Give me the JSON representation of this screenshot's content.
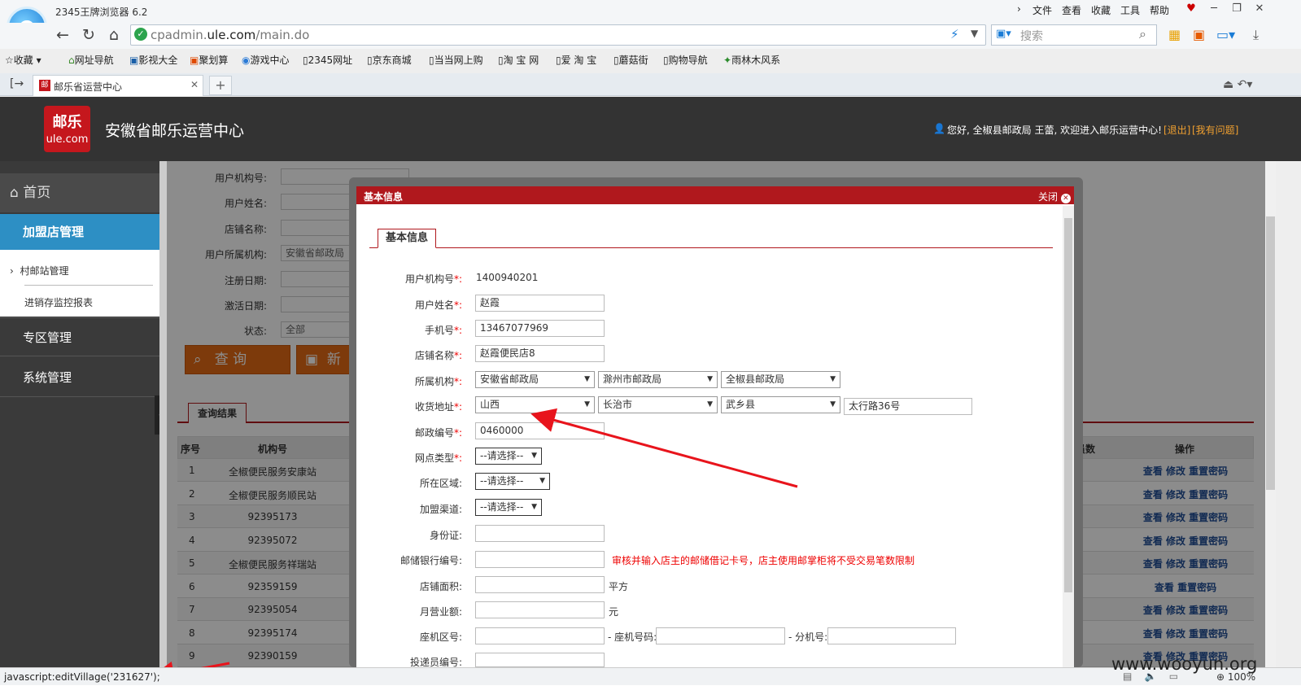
{
  "browser": {
    "app_title": "2345王牌浏览器 6.2",
    "menu": [
      "文件",
      "查看",
      "收藏",
      "工具",
      "帮助"
    ],
    "url_host": "cpadmin.",
    "url_domain": "ule.com",
    "url_path": "/main.do",
    "search_placeholder": "搜索",
    "bookmarks": [
      "收藏",
      "网址导航",
      "影视大全",
      "聚划算",
      "游戏中心",
      "2345网址",
      "京东商城",
      "当当网上购",
      "淘 宝 网",
      "爱 淘 宝",
      "蘑菇街",
      "购物导航",
      "雨林木风系"
    ],
    "tab_title": "邮乐省运营中心",
    "status_text": "javascript:editVillage('231627');",
    "zoom": "100%"
  },
  "header": {
    "logo_top": "邮乐",
    "logo_bottom": "ule.com",
    "site_title": "安徽省邮乐运营中心",
    "greeting": "您好, 全椒县邮政局 王蕾, 欢迎进入邮乐运营中心!",
    "logout": "[退出]",
    "help": "[我有问题]"
  },
  "sidebar": {
    "home": "首页",
    "franchise": "加盟店管理",
    "sub1": "村邮站管理",
    "sub2": "进销存监控报表",
    "zone": "专区管理",
    "system": "系统管理"
  },
  "search_form": {
    "labels": [
      "用户机构号:",
      "用户姓名:",
      "店铺名称:",
      "用户所属机构:",
      "注册日期:",
      "激活日期:",
      "状态:"
    ],
    "org_value": "安徽省邮政局",
    "status_value": "全部",
    "query_btn": "查 询",
    "new_btn": "新增"
  },
  "results": {
    "tab_label": "查询结果",
    "col_seq": "序号",
    "col_org": "机构号",
    "col_staff": "员数",
    "col_ops": "操作",
    "rows": [
      {
        "seq": "1",
        "org": "全椒便民服务安康站",
        "ops": "查看 修改 重置密码"
      },
      {
        "seq": "2",
        "org": "全椒便民服务顺民站",
        "ops": "查看 修改 重置密码"
      },
      {
        "seq": "3",
        "org": "92395173",
        "ops": "查看 修改 重置密码"
      },
      {
        "seq": "4",
        "org": "92395072",
        "ops": "查看 修改 重置密码"
      },
      {
        "seq": "5",
        "org": "全椒便民服务祥瑞站",
        "ops": "查看 修改 重置密码"
      },
      {
        "seq": "6",
        "org": "92359159",
        "ops": "查看 重置密码"
      },
      {
        "seq": "7",
        "org": "92395054",
        "ops": "查看 修改 重置密码"
      },
      {
        "seq": "8",
        "org": "92395174",
        "ops": "查看 修改 重置密码"
      },
      {
        "seq": "9",
        "org": "92390159",
        "ops": "查看 修改 重置密码"
      }
    ]
  },
  "modal": {
    "title": "基本信息",
    "close": "关闭",
    "section_tab": "基本信息",
    "req_mark": "*:",
    "colon": ":",
    "label_user_org": "用户机构号",
    "user_org_value": "1400940201",
    "label_name": "用户姓名",
    "name_value": "赵霞",
    "label_phone": "手机号",
    "phone_value": "13467077969",
    "label_store": "店铺名称",
    "store_value": "赵霞便民店8",
    "label_org": "所属机构",
    "org1": "安徽省邮政局",
    "org2": "滁州市邮政局",
    "org3": "全椒县邮政局",
    "label_addr": "收货地址",
    "addr1": "山西",
    "addr2": "长治市",
    "addr3": "武乡县",
    "addr_detail": "太行路36号",
    "label_zip": "邮政编号",
    "zip_value": "0460000",
    "label_type": "网点类型",
    "label_area": "所在区域",
    "label_channel": "加盟渠道",
    "select_default": "--请选择--",
    "label_id": "身份证:",
    "label_bank": "邮储银行编号:",
    "bank_hint": "审核并输入店主的邮储借记卡号，店主使用邮掌柜将不受交易笔数限制",
    "label_area_size": "店铺面积:",
    "area_unit": "平方",
    "label_revenue": "月营业额:",
    "revenue_unit": "元",
    "label_tel_area": "座机区号:",
    "label_tel_num": "- 座机号码:",
    "label_tel_ext": "- 分机号:",
    "label_courier": "投递员编号:"
  },
  "watermark": "www.wooyun.org",
  "colors": {
    "accent_red": "#b0181d",
    "sidebar_active": "#2d8fc4",
    "orange": "#e46b14",
    "link_blue": "#1f4d96"
  }
}
